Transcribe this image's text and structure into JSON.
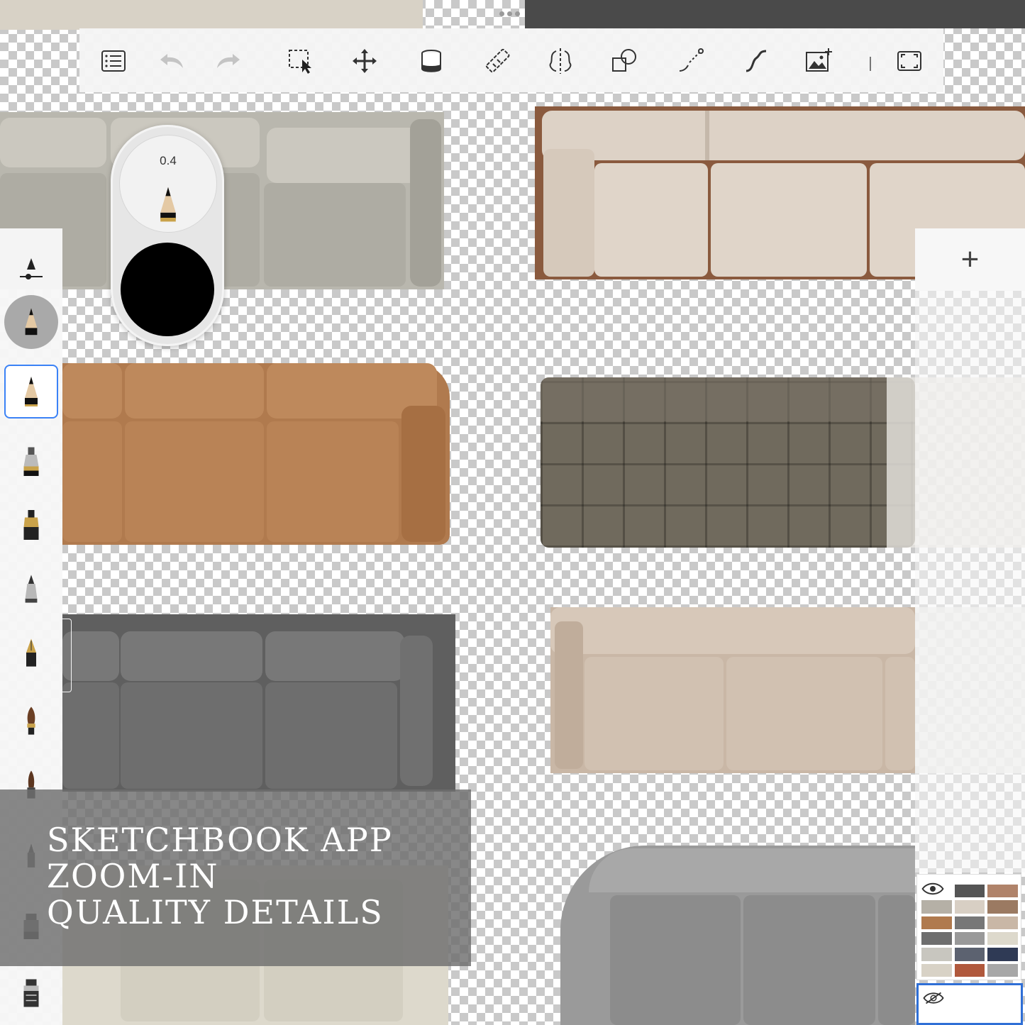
{
  "toolbar": {
    "tools": [
      {
        "name": "layers-menu-icon"
      },
      {
        "name": "undo-icon"
      },
      {
        "name": "redo-icon"
      },
      {
        "name": "selection-tool-icon"
      },
      {
        "name": "transform-move-icon"
      },
      {
        "name": "fill-bucket-icon"
      },
      {
        "name": "ruler-icon"
      },
      {
        "name": "symmetry-icon"
      },
      {
        "name": "shape-tool-icon"
      },
      {
        "name": "stroke-tool-icon"
      },
      {
        "name": "curve-icon"
      },
      {
        "name": "add-image-icon"
      },
      {
        "name": "fullscreen-icon"
      }
    ]
  },
  "brush_puck": {
    "size_value": "0.4",
    "color": "#000000"
  },
  "layers": {
    "add_label": "+"
  },
  "caption": {
    "line1": "SKETCHBOOK APP",
    "line2": "ZOOM-IN",
    "line3": "QUALITY DETAILS"
  },
  "colors": {
    "accent": "#3b82f6",
    "selected_layer_border": "#2f6fd6"
  }
}
